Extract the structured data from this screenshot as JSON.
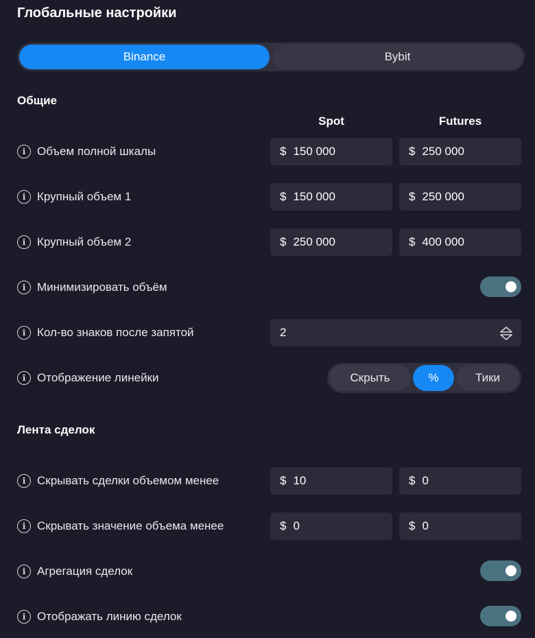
{
  "header": {
    "title": "Глобальные настройки"
  },
  "exchanges": {
    "tabs": [
      "Binance",
      "Bybit"
    ],
    "active": "Binance"
  },
  "general": {
    "title": "Общие",
    "columns": {
      "spot": "Spot",
      "futures": "Futures"
    },
    "full_scale_volume": {
      "label": "Объем полной шкалы",
      "currency": "$",
      "spot": "150 000",
      "futures": "250 000"
    },
    "large_volume_1": {
      "label": "Крупный объем 1",
      "currency": "$",
      "spot": "150 000",
      "futures": "250 000"
    },
    "large_volume_2": {
      "label": "Крупный объем 2",
      "currency": "$",
      "spot": "250 000",
      "futures": "400 000"
    },
    "minimize_volume": {
      "label": "Минимизировать объём",
      "enabled": true
    },
    "decimal_places": {
      "label": "Кол-во знаков после запятой",
      "value": "2"
    },
    "ruler_display": {
      "label": "Отображение линейки",
      "options": [
        "Скрыть",
        "%",
        "Тики"
      ],
      "selected": "%"
    }
  },
  "trades_feed": {
    "title": "Лента сделок",
    "hide_trades_below": {
      "label": "Скрывать сделки объемом менее",
      "currency": "$",
      "spot": "10",
      "futures": "0"
    },
    "hide_volume_value_below": {
      "label": "Скрывать значение объема менее",
      "currency": "$",
      "spot": "0",
      "futures": "0"
    },
    "trade_aggregation": {
      "label": "Агрегация сделок",
      "enabled": true
    },
    "show_trade_line": {
      "label": "Отображать линию сделок",
      "enabled": true
    }
  },
  "icons": {
    "info": "info-circle-icon",
    "stepper": "up-down-arrows-icon"
  },
  "colors": {
    "background": "#1c1b29",
    "accent": "#1588f3",
    "toggle_on": "#4b7280",
    "field": "#2c2b3a"
  }
}
